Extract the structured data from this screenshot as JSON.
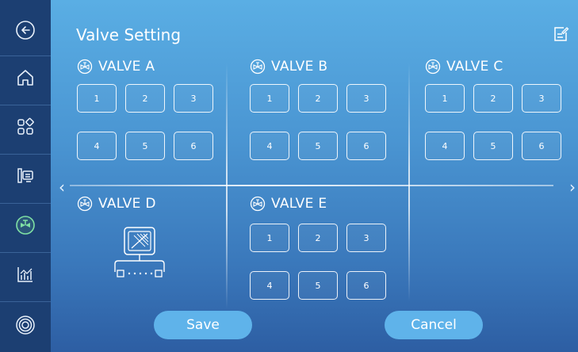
{
  "page": {
    "title": "Valve Setting"
  },
  "sidebar": {
    "items": [
      {
        "icon": "back-arrow-icon"
      },
      {
        "icon": "home-icon"
      },
      {
        "icon": "apps-grid-icon"
      },
      {
        "icon": "device-monitor-icon"
      },
      {
        "icon": "valve-icon",
        "active": true
      },
      {
        "icon": "chart-icon"
      },
      {
        "icon": "settings-ring-icon"
      }
    ]
  },
  "valves": [
    {
      "name": "VALVE A",
      "buttons": [
        "1",
        "2",
        "3",
        "4",
        "5",
        "6"
      ]
    },
    {
      "name": "VALVE B",
      "buttons": [
        "1",
        "2",
        "3",
        "4",
        "5",
        "6"
      ]
    },
    {
      "name": "VALVE C",
      "buttons": [
        "1",
        "2",
        "3",
        "4",
        "5",
        "6"
      ]
    },
    {
      "name": "VALVE D",
      "buttons": []
    },
    {
      "name": "VALVE E",
      "buttons": [
        "1",
        "2",
        "3",
        "4",
        "5",
        "6"
      ]
    }
  ],
  "actions": {
    "save_label": "Save",
    "cancel_label": "Cancel"
  },
  "colors": {
    "sidebar_bg": "#1c3f72",
    "panel_top": "#5aaee4",
    "panel_bottom": "#2d5ea3",
    "button_bg": "#5fb3ea",
    "active_icon": "#7fe0a4"
  }
}
